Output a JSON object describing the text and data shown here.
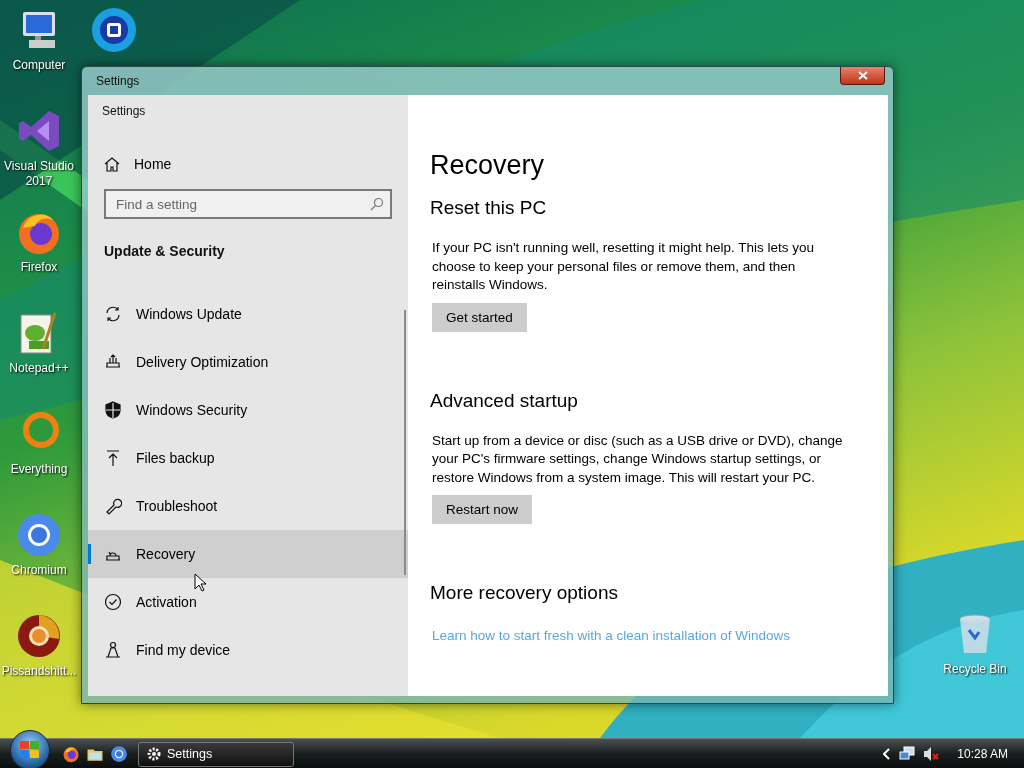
{
  "desktop_icons": [
    {
      "kind": "computer",
      "label": "Computer"
    },
    {
      "kind": "visual-studio",
      "label": "Visual Studio 2017"
    },
    {
      "kind": "firefox",
      "label": "Firefox"
    },
    {
      "kind": "notepad",
      "label": "Notepad++"
    },
    {
      "kind": "everything",
      "label": "Everything"
    },
    {
      "kind": "chromium",
      "label": "Chromium"
    },
    {
      "kind": "chrome",
      "label": "Pissandshitt..."
    }
  ],
  "desktop_icon_2": {
    "kind": "blue-circle"
  },
  "recycle_bin": {
    "kind": "recycle-bin",
    "label": "Recycle Bin"
  },
  "window": {
    "title": "Settings"
  },
  "sidebar": {
    "app_title": "Settings",
    "home": "Home",
    "search": {
      "placeholder": "Find a setting"
    },
    "section": "Update & Security",
    "items": [
      {
        "kind": "sync",
        "label": "Windows Update",
        "selected": false
      },
      {
        "kind": "delivery",
        "label": "Delivery Optimization",
        "selected": false
      },
      {
        "kind": "shield",
        "label": "Windows Security",
        "selected": false
      },
      {
        "kind": "upload",
        "label": "Files backup",
        "selected": false
      },
      {
        "kind": "wrench",
        "label": "Troubleshoot",
        "selected": false
      },
      {
        "kind": "recovery",
        "label": "Recovery",
        "selected": true
      },
      {
        "kind": "check",
        "label": "Activation",
        "selected": false
      },
      {
        "kind": "person",
        "label": "Find my device",
        "selected": false
      }
    ]
  },
  "content": {
    "title": "Recovery",
    "sections": [
      {
        "heading": "Reset this PC",
        "text": "If your PC isn't running well, resetting it might help. This lets you choose to keep your personal files or remove them, and then reinstalls Windows.",
        "button": "Get started"
      },
      {
        "heading": "Advanced startup",
        "text": "Start up from a device or disc (such as a USB drive or DVD), change your PC's firmware settings, change Windows startup settings, or restore Windows from a system image. This will restart your PC.",
        "button": "Restart now"
      }
    ],
    "more": {
      "heading": "More recovery options",
      "link": "Learn how to start fresh with a clean installation of Windows"
    }
  },
  "taskbar": {
    "quick_launch": [
      {
        "kind": "firefox"
      },
      {
        "kind": "folder"
      },
      {
        "kind": "chromium"
      }
    ],
    "task": "Settings",
    "clock": "10:28 AM"
  }
}
